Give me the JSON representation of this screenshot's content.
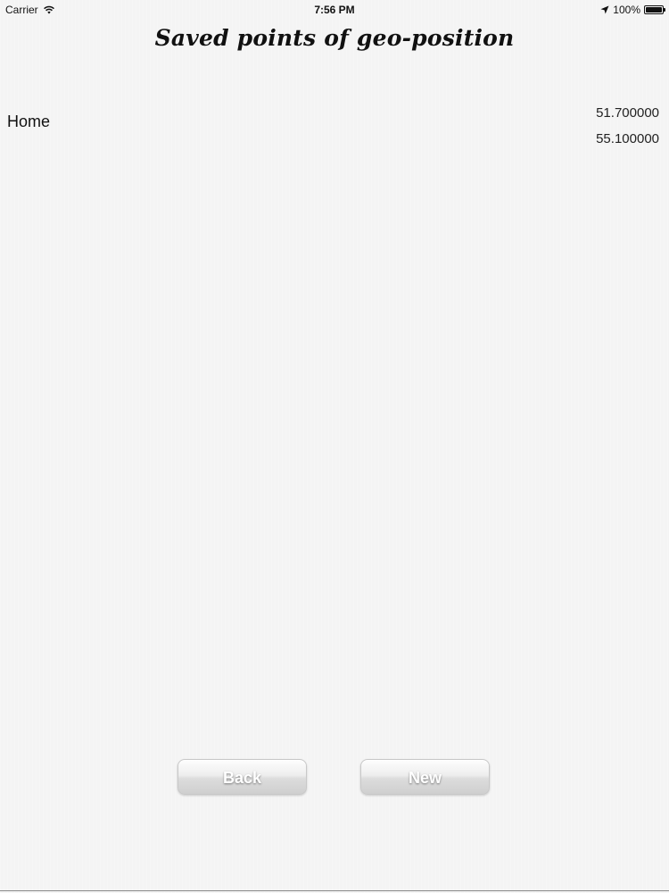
{
  "status_bar": {
    "carrier": "Carrier",
    "time": "7:56 PM",
    "battery_percent": "100%",
    "battery_level": 1.0,
    "icons": [
      "wifi-icon",
      "location-arrow-icon",
      "battery-icon"
    ]
  },
  "page": {
    "title": "Saved points of geo-position"
  },
  "points": [
    {
      "name": "Home",
      "coord_1": "51.700000",
      "coord_2": "55.100000"
    }
  ],
  "buttons": {
    "back_label": "Back",
    "new_label": "New"
  },
  "colors": {
    "background": "#f4f4f4",
    "text": "#111111",
    "button_text": "#ffffff"
  }
}
